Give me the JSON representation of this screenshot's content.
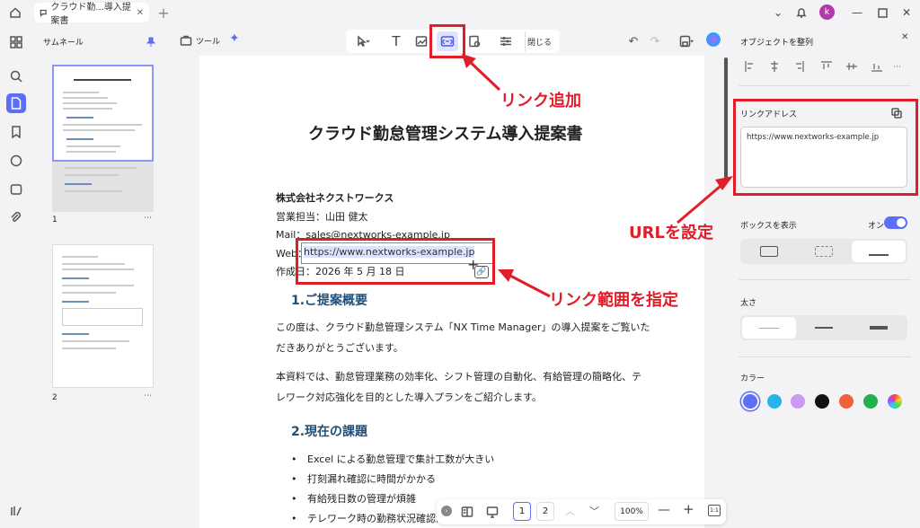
{
  "titlebar": {
    "tab_title": "クラウド勤...導入提案書",
    "avatar_initial": "k"
  },
  "thumbnails": {
    "title": "サムネール",
    "pages": [
      {
        "label": "1"
      },
      {
        "label": "2"
      }
    ]
  },
  "toolbar": {
    "tools_label": "ツール",
    "close_label": "閉じる"
  },
  "document": {
    "title": "クラウド勤怠管理システム導入提案書",
    "company": "株式会社ネクストワークス",
    "rep": "営業担当：山田 健太",
    "mail": "Mail：sales@nextworks-example.jp",
    "web_label": "Web：",
    "web_url": "https://www.nextworks-example.jp",
    "date": "作成日：2026 年 5 月 18 日",
    "h1": "1.ご提案概要",
    "p1a": "この度は、クラウド勤怠管理システム「NX Time Manager」の導入提案をご覧いた",
    "p1b": "だきありがとうございます。",
    "p2a": "本資料では、勤怠管理業務の効率化、シフト管理の自動化、有給管理の簡略化、テ",
    "p2b": "レワーク対応強化を目的とした導入プランをご紹介します。",
    "h2": "2.現在の課題",
    "bullets": [
      "Excel による勤怠管理で集計工数が大きい",
      "打刻漏れ確認に時間がかかる",
      "有給残日数の管理が煩雑",
      "テレワーク時の勤務状況確認が"
    ]
  },
  "annotations": {
    "link_add": "リンク追加",
    "url_set": "URLを設定",
    "range_set": "リンク範囲を指定"
  },
  "right_panel": {
    "align_title": "オブジェクトを整列",
    "link_address_label": "リンクアドレス",
    "link_address_value": "https://www.nextworks-example.jp",
    "show_box_label": "ボックスを表示",
    "show_box_state": "オン",
    "thickness_label": "太さ",
    "color_label": "カラー",
    "colors": [
      "#5b6ef5",
      "#27b4ea",
      "#c89af0",
      "#111111",
      "#f0603a",
      "#23b04e",
      "rainbow"
    ]
  },
  "bottombar": {
    "page1": "1",
    "page2": "2",
    "zoom": "100%"
  }
}
